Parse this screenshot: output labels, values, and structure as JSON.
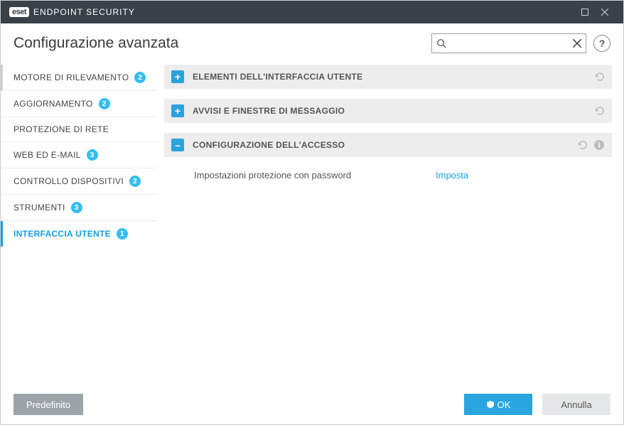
{
  "titlebar": {
    "product": "ENDPOINT SECURITY",
    "logo": "eset"
  },
  "header": {
    "title": "Configurazione avanzata"
  },
  "search": {
    "placeholder": ""
  },
  "help": {
    "label": "?"
  },
  "sidebar": {
    "items": [
      {
        "label": "MOTORE DI RILEVAMENTO",
        "badge": "2",
        "active": false,
        "marked": true
      },
      {
        "label": "AGGIORNAMENTO",
        "badge": "2",
        "active": false,
        "marked": false
      },
      {
        "label": "PROTEZIONE DI RETE",
        "badge": "",
        "active": false,
        "marked": false
      },
      {
        "label": "WEB ED E-MAIL",
        "badge": "3",
        "active": false,
        "marked": false
      },
      {
        "label": "CONTROLLO DISPOSITIVI",
        "badge": "2",
        "active": false,
        "marked": false
      },
      {
        "label": "STRUMENTI",
        "badge": "3",
        "active": false,
        "marked": false
      },
      {
        "label": "INTERFACCIA UTENTE",
        "badge": "1",
        "active": true,
        "marked": false
      }
    ]
  },
  "sections": [
    {
      "title": "ELEMENTI DELL'INTERFACCIA UTENTE",
      "expanded": false,
      "has_info": false
    },
    {
      "title": "AVVISI E FINESTRE DI MESSAGGIO",
      "expanded": false,
      "has_info": false
    },
    {
      "title": "CONFIGURAZIONE DELL'ACCESSO",
      "expanded": true,
      "has_info": true,
      "rows": [
        {
          "label": "Impostazioni protezione con password",
          "value": "Imposta"
        }
      ]
    }
  ],
  "footer": {
    "default_label": "Predefinito",
    "ok_label": "OK",
    "cancel_label": "Annulla"
  }
}
